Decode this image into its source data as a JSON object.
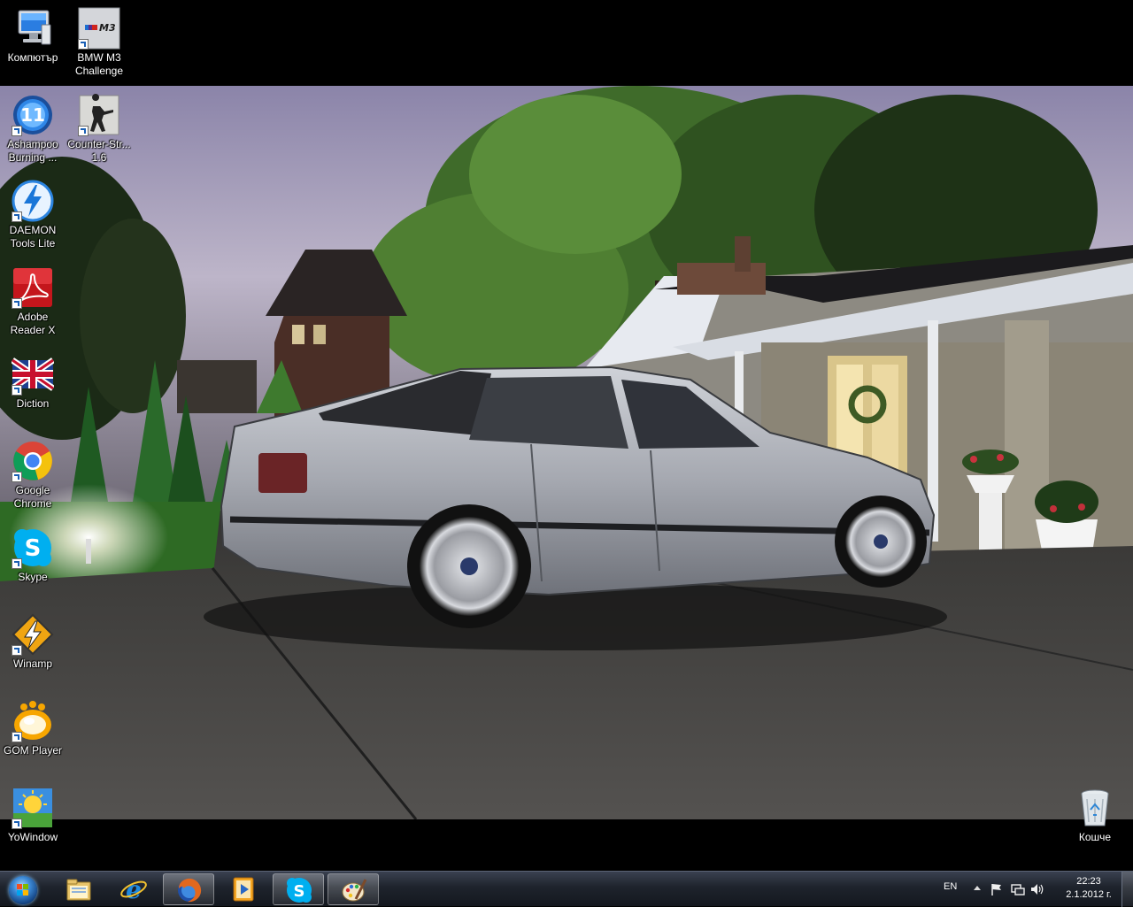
{
  "desktop": {
    "icons": [
      {
        "label": "Компютър",
        "icon": "computer-icon"
      },
      {
        "label": "BMW M3 Challenge",
        "icon": "bmw-m3-icon"
      },
      {
        "label": "Ashampoo Burning ...",
        "icon": "ashampoo-burning-icon"
      },
      {
        "label": "Counter-Str... 1.6",
        "icon": "counter-strike-icon"
      },
      {
        "label": "DAEMON Tools Lite",
        "icon": "daemon-tools-icon"
      },
      {
        "label": "Adobe Reader X",
        "icon": "adobe-reader-icon"
      },
      {
        "label": "Diction",
        "icon": "diction-uk-flag-icon"
      },
      {
        "label": "Google Chrome",
        "icon": "chrome-icon"
      },
      {
        "label": "Skype",
        "icon": "skype-icon"
      },
      {
        "label": "Winamp",
        "icon": "winamp-icon"
      },
      {
        "label": "GOM Player",
        "icon": "gom-player-icon"
      },
      {
        "label": "YoWindow",
        "icon": "yowindow-icon"
      },
      {
        "label": "Кошче",
        "icon": "recycle-bin-icon"
      }
    ],
    "m3_badge": "M3",
    "ashampoo_badge": "11",
    "skype_badge": "S",
    "wallpaper": "silver-bmw-sedan-night-driveway"
  },
  "taskbar": {
    "start": "windows-start-orb",
    "pinned": [
      {
        "icon": "explorer-folder-icon",
        "active": false
      },
      {
        "icon": "internet-explorer-icon",
        "active": false
      },
      {
        "icon": "firefox-icon",
        "active": true
      },
      {
        "icon": "media-player-icon",
        "active": false
      },
      {
        "icon": "skype-icon",
        "active": true
      },
      {
        "icon": "paint-icon",
        "active": true
      }
    ],
    "skype_glyph": "S",
    "ie_glyph": "e"
  },
  "tray": {
    "language": "EN",
    "time": "22:23",
    "date": "2.1.2012 г."
  },
  "colors": {
    "taskbar": "#1e232c",
    "label_text": "#ffffff"
  }
}
